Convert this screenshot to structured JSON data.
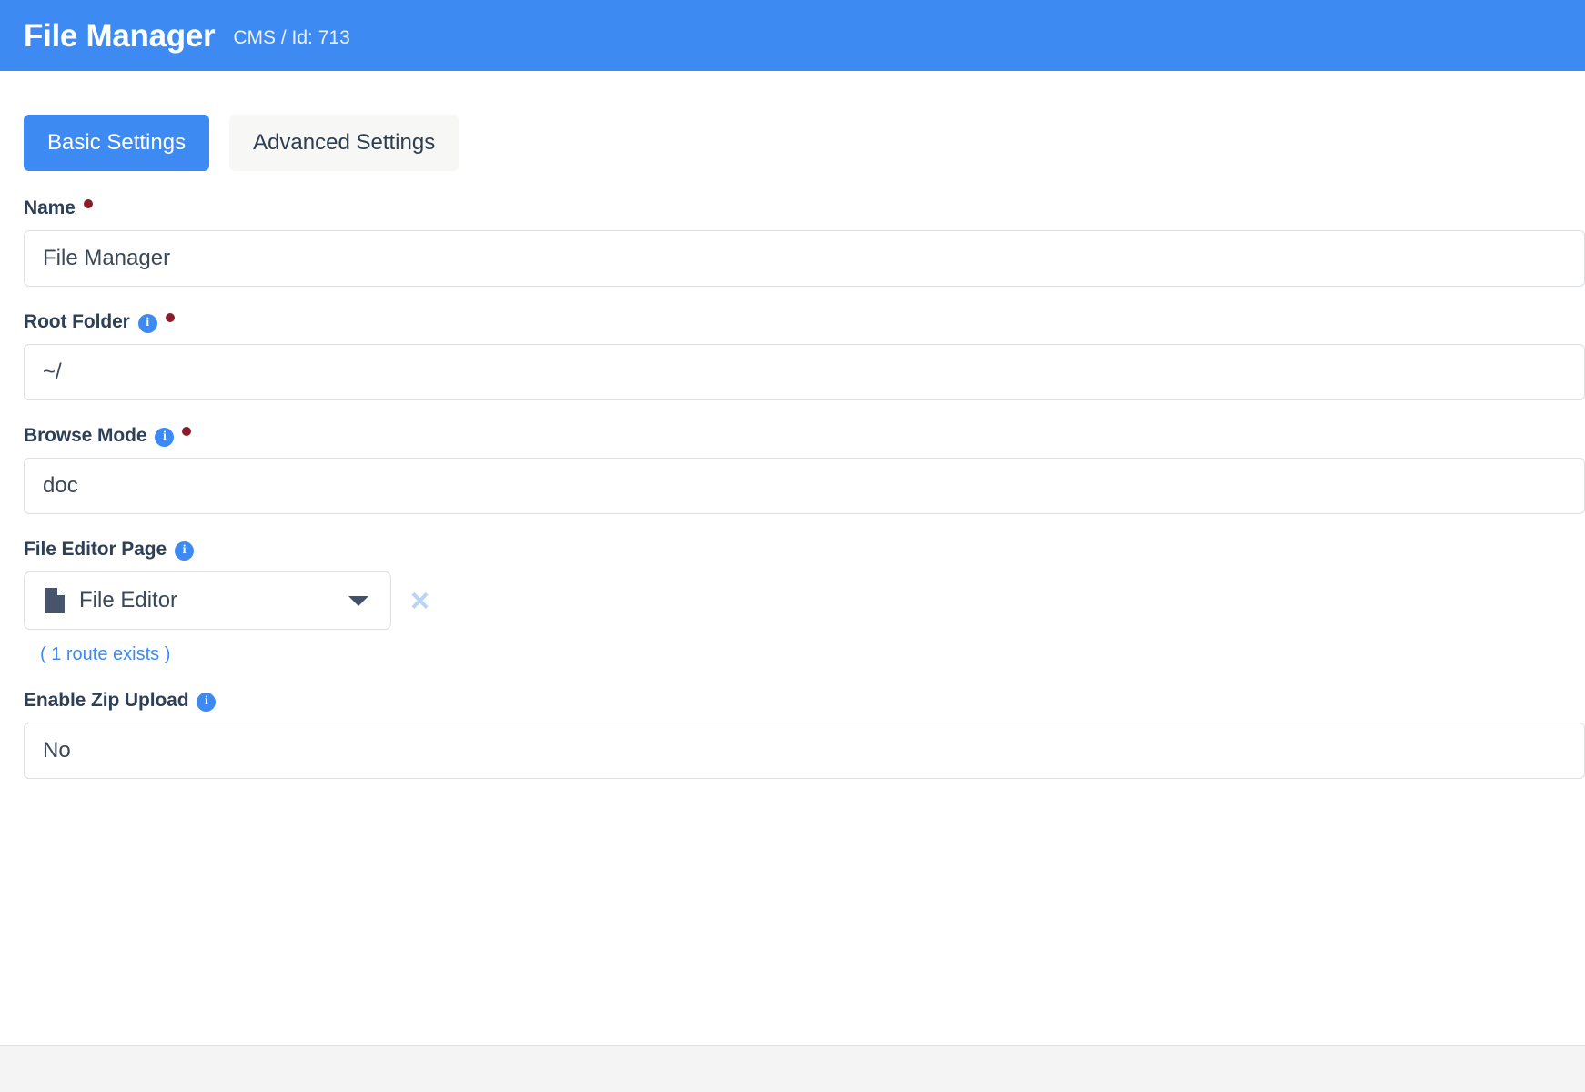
{
  "header": {
    "title": "File Manager",
    "subtitle": "CMS / Id: 713",
    "background_color": "#3d8bf2"
  },
  "tabs": [
    {
      "label": "Basic Settings",
      "active": true
    },
    {
      "label": "Advanced Settings",
      "active": false
    }
  ],
  "form": {
    "fields": [
      {
        "label": "Name",
        "required": true,
        "has_info": false,
        "type": "text",
        "value": "File Manager",
        "placeholder": ""
      },
      {
        "label": "Root Folder",
        "required": true,
        "has_info": true,
        "info_icon": "info-icon",
        "type": "text",
        "value": "~/",
        "placeholder": ""
      },
      {
        "label": "Browse Mode",
        "required": true,
        "has_info": true,
        "info_icon": "info-icon",
        "type": "text",
        "value": "doc",
        "placeholder": ""
      },
      {
        "label": "File Editor Page",
        "required": false,
        "has_info": true,
        "info_icon": "info-icon",
        "type": "select",
        "value": "File Editor",
        "option_icon": "document-icon",
        "caret_icon": "chevron-down-icon",
        "clear_icon": "close-icon",
        "clear_label": "×",
        "hint": "( 1 route exists )"
      },
      {
        "label": "Enable Zip Upload",
        "required": false,
        "has_info": true,
        "info_icon": "info-icon",
        "type": "text",
        "value": "No",
        "placeholder": ""
      }
    ]
  },
  "colors": {
    "accent": "#3d8bf2",
    "required_dot": "#8b1c2b",
    "label_text": "#2e4057",
    "hint_text": "#3d8bf2",
    "clear_icon": "#b9d5f5",
    "footer_bg": "#f4f4f4"
  }
}
